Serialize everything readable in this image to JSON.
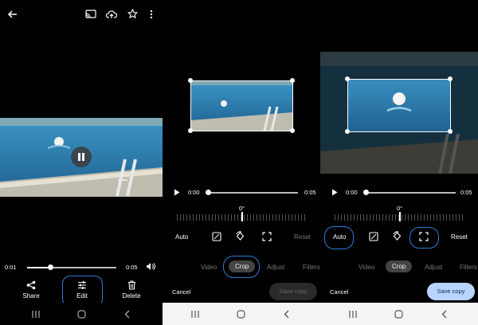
{
  "viewer": {
    "progress": 0.26,
    "time_current": "0:01",
    "time_total": "0:05",
    "actions": [
      {
        "label": "Share",
        "icon": "share-icon"
      },
      {
        "label": "Edit",
        "icon": "tune-icon"
      },
      {
        "label": "Delete",
        "icon": "trash-icon"
      }
    ],
    "top_icons": [
      "back-arrow-icon",
      "cast-icon",
      "cloud-upload-icon",
      "star-icon",
      "more-vert-icon"
    ]
  },
  "editor_middle": {
    "time_current": "0:00",
    "time_total": "0:05",
    "angle": "0°",
    "auto_label": "Auto",
    "reset_label": "Reset",
    "tabs": [
      "Video",
      "Crop",
      "Adjust",
      "Filters"
    ],
    "active_tab": "Crop",
    "cancel_label": "Cancel",
    "save_label": "Save copy",
    "save_enabled": false
  },
  "editor_right": {
    "time_current": "0:00",
    "time_total": "0:05",
    "angle": "0°",
    "auto_label": "Auto",
    "reset_label": "Reset",
    "tabs": [
      "Video",
      "Crop",
      "Adjust",
      "Filters"
    ],
    "active_tab": "Crop",
    "cancel_label": "Cancel",
    "save_label": "Save copy",
    "save_enabled": true
  },
  "colors": {
    "highlight": "#2f7ad8",
    "save_active": "#b9d4ff",
    "navbar_light": "#f4f4f4"
  }
}
